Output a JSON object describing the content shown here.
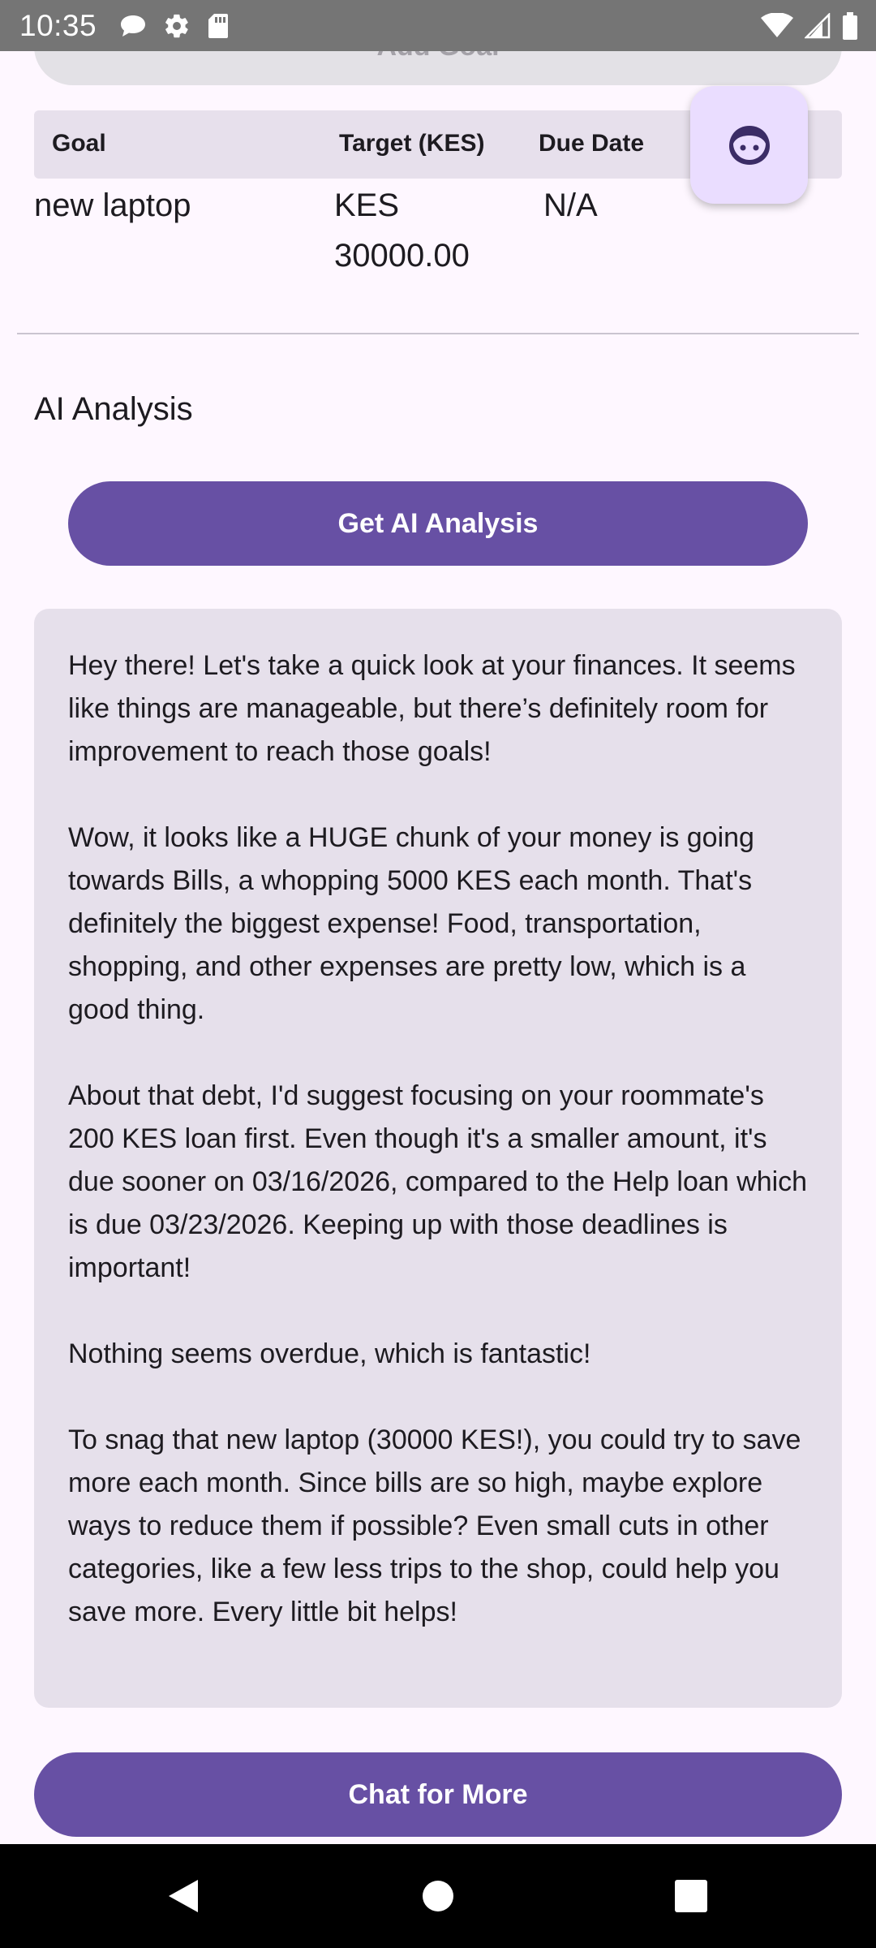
{
  "status_bar": {
    "time": "10:35",
    "left_icons": [
      "chat-bubble-icon",
      "gear-icon",
      "sd-card-icon"
    ],
    "right_icons": [
      "wifi-icon",
      "cell-signal-icon",
      "battery-icon"
    ]
  },
  "top_button": {
    "label": "Add Goal"
  },
  "goals_table": {
    "headers": {
      "goal": "Goal",
      "target": "Target (KES)",
      "due": "Due Date"
    },
    "rows": [
      {
        "goal": "new laptop",
        "target": "KES 30000.00",
        "due": "N/A"
      }
    ]
  },
  "ai_section": {
    "title": "AI Analysis",
    "get_button": "Get AI Analysis",
    "paragraphs": [
      "Hey there! Let's take a quick look at your finances. It seems like things are manageable, but there’s definitely room for improvement to reach those goals!",
      "Wow, it looks like a HUGE chunk of your money is going towards Bills, a whopping 5000 KES each month. That's definitely the biggest expense! Food, transportation, shopping, and other expenses are pretty low, which is a good thing.",
      "About that debt, I'd suggest focusing on your roommate's 200 KES loan first. Even though it's a smaller amount, it's due sooner on 03/16/2026, compared to the Help loan which is due 03/23/2026. Keeping up with those deadlines is important!",
      "Nothing seems overdue, which is fantastic!",
      "To snag that new laptop (30000 KES!), you could try to save more each month. Since bills are so high, maybe explore ways to reduce them if possible? Even small cuts in other categories, like a few less trips to the shop, could help you save more. Every little bit helps!"
    ],
    "chat_button": "Chat for More"
  },
  "fab": {
    "icon": "chatbot-face-icon"
  },
  "nav_bar": {
    "icons": [
      "back-icon",
      "home-icon",
      "recents-icon"
    ]
  },
  "colors": {
    "primary": "#6750A4",
    "surface": "#FEF7FF",
    "card": "#E6E0EB",
    "table_header": "#E7E0EC",
    "fab": "#EADDFF"
  }
}
